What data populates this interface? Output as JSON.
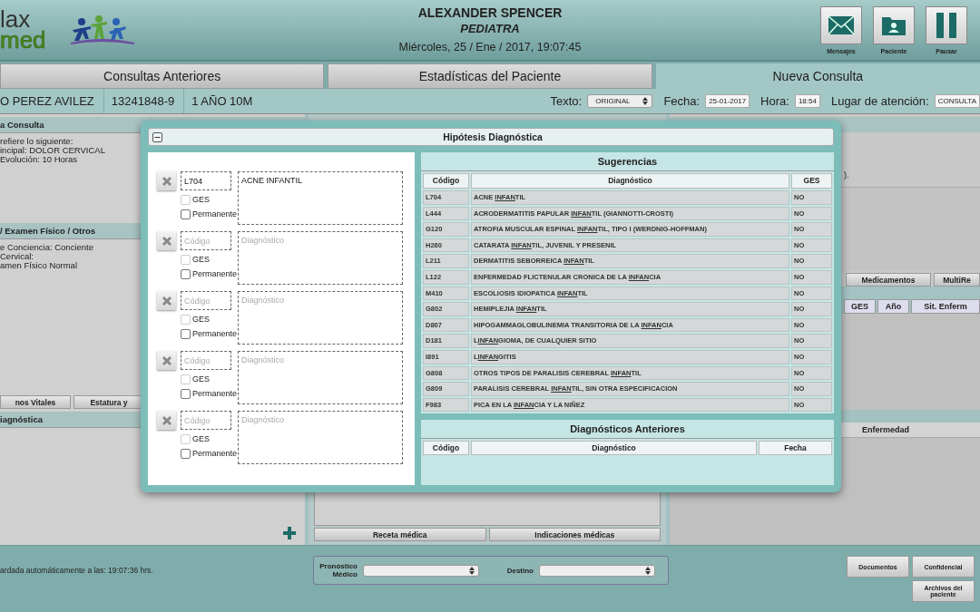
{
  "header": {
    "logo_top": "lax",
    "logo_bottom": "med",
    "doctor": "ALEXANDER SPENCER",
    "specialty": "PEDIATRA",
    "datetime": "Miércoles, 25 / Ene / 2017, 19:07:45",
    "actions": [
      {
        "kind": "mail",
        "label": "Mensajes"
      },
      {
        "kind": "patient",
        "label": "Paciente"
      },
      {
        "kind": "pause",
        "label": "Pausar"
      }
    ]
  },
  "tabs": [
    {
      "label": "Consultas Anteriores",
      "selected": false
    },
    {
      "label": "Estadísticas del Paciente",
      "selected": false
    },
    {
      "label": "Nueva Consulta",
      "selected": true
    }
  ],
  "patient": {
    "name": "O PEREZ AVILEZ",
    "rut": "13241848-9",
    "age": "1 AÑO 10M",
    "text_label": "Texto:",
    "text_value": "ORIGINAL",
    "date_label": "Fecha:",
    "date": "25-01-2017",
    "time_label": "Hora:",
    "time": "18:54",
    "place_label": "Lugar de atención:",
    "place": "CONSULTA"
  },
  "left_panel": {
    "sections": [
      {
        "title": "a Consulta",
        "lines": [
          "refiere lo siguiente:",
          "incipal: DOLOR CERVICAL",
          "Evolución: 10 Horas"
        ]
      },
      {
        "title": "/ Examen Físico / Otros",
        "lines": [
          "e Conciencia: Conciente",
          "Cervical:",
          "amen Físico Normal"
        ]
      }
    ],
    "buttons": [
      "nos Vitales",
      "Estatura y"
    ],
    "diagnosis_title": "iagnóstica"
  },
  "center_panel": {
    "buttons": [
      "Receta médica",
      "Indicaciones médicas"
    ]
  },
  "right_panel": {
    "note": ").",
    "buttons": [
      "Medicamentos",
      "MultiRe"
    ],
    "columns": [
      "GES",
      "Año",
      "Sit. Enferm"
    ],
    "family_column": "Enfermedad"
  },
  "modal": {
    "title": "Hipótesis Diagnóstica",
    "entries": [
      {
        "code": "L704",
        "diagnosis": "ACNE INFANTIL",
        "ges": false,
        "ges_disabled": true,
        "ges_label": "GES",
        "permanent": false,
        "permanent_label": "Permanente"
      },
      {
        "code_placeholder": "Código",
        "diagnosis_placeholder": "Diagnóstico",
        "ges": false,
        "ges_disabled": true,
        "ges_label": "GES",
        "permanent": false,
        "permanent_label": "Permanente"
      },
      {
        "code_placeholder": "Código",
        "diagnosis_placeholder": "Diagnóstico",
        "ges": false,
        "ges_disabled": true,
        "ges_label": "GES",
        "permanent": false,
        "permanent_label": "Permanente"
      },
      {
        "code_placeholder": "Código",
        "diagnosis_placeholder": "Diagnóstico",
        "ges": false,
        "ges_disabled": true,
        "ges_label": "GES",
        "permanent": false,
        "permanent_label": "Permanente"
      },
      {
        "code_placeholder": "Código",
        "diagnosis_placeholder": "Diagnóstico",
        "ges": false,
        "ges_disabled": true,
        "ges_label": "GES",
        "permanent": false,
        "permanent_label": "Permanente"
      }
    ],
    "suggestions": {
      "title": "Sugerencias",
      "columns": [
        "Código",
        "Diagnóstico",
        "GES"
      ],
      "rows": [
        {
          "code": "L704",
          "diagnosis": [
            "ACNE ",
            "INFAN",
            "TIL"
          ],
          "ges": "NO"
        },
        {
          "code": "L444",
          "diagnosis": [
            "ACRODERMATITIS PAPULAR ",
            "INFAN",
            "TIL (GIANNOTTI-CROSTI)"
          ],
          "ges": "NO"
        },
        {
          "code": "G120",
          "diagnosis": [
            "ATROFIA MUSCULAR ESPINAL ",
            "INFAN",
            "TIL, TIPO I (WERDNIG-HOFFMAN)"
          ],
          "ges": "NO"
        },
        {
          "code": "H260",
          "diagnosis": [
            "CATARATA ",
            "INFAN",
            "TIL, JUVENIL Y PRESENIL"
          ],
          "ges": "NO"
        },
        {
          "code": "L211",
          "diagnosis": [
            "DERMATITIS SEBORREICA ",
            "INFAN",
            "TIL"
          ],
          "ges": "NO"
        },
        {
          "code": "L122",
          "diagnosis": [
            "ENFERMEDAD FLICTENULAR CRONICA DE LA ",
            "INFAN",
            "CIA"
          ],
          "ges": "NO"
        },
        {
          "code": "M410",
          "diagnosis": [
            "ESCOLIOSIS IDIOPATICA ",
            "INFAN",
            "TIL"
          ],
          "ges": "NO"
        },
        {
          "code": "G802",
          "diagnosis": [
            "HEMIPLEJIA ",
            "INFAN",
            "TIL"
          ],
          "ges": "NO"
        },
        {
          "code": "D807",
          "diagnosis": [
            "HIPOGAMMAGLOBULINEMIA TRANSITORIA DE LA ",
            "INFAN",
            "CIA"
          ],
          "ges": "NO"
        },
        {
          "code": "D181",
          "diagnosis": [
            "L",
            "INFAN",
            "GIOMA, DE CUALQUIER SITIO"
          ],
          "ges": "NO"
        },
        {
          "code": "I891",
          "diagnosis": [
            "L",
            "INFAN",
            "GITIS"
          ],
          "ges": "NO"
        },
        {
          "code": "G808",
          "diagnosis": [
            "OTROS TIPOS DE PARALISIS CEREBRAL ",
            "INFAN",
            "TIL"
          ],
          "ges": "NO"
        },
        {
          "code": "G809",
          "diagnosis": [
            "PARALISIS CEREBRAL ",
            "INFAN",
            "TIL, SIN OTRA ESPECIFICACION"
          ],
          "ges": "NO"
        },
        {
          "code": "F983",
          "diagnosis": [
            "PICA EN LA ",
            "INFAN",
            "CIA Y LA NIÑEZ"
          ],
          "ges": "NO"
        }
      ]
    },
    "previous": {
      "title": "Diagnósticos Anteriores",
      "columns": [
        "Código",
        "Diagnóstico",
        "Fecha"
      ]
    }
  },
  "footer": {
    "autosave": "ardada automáticamente a las: 19:07:36 hrs.",
    "prognosis_label": "Pronóstico Médico",
    "destination_label": "Destino",
    "buttons": [
      "Documentos",
      "Confidencial",
      "Archivos del paciente"
    ]
  }
}
